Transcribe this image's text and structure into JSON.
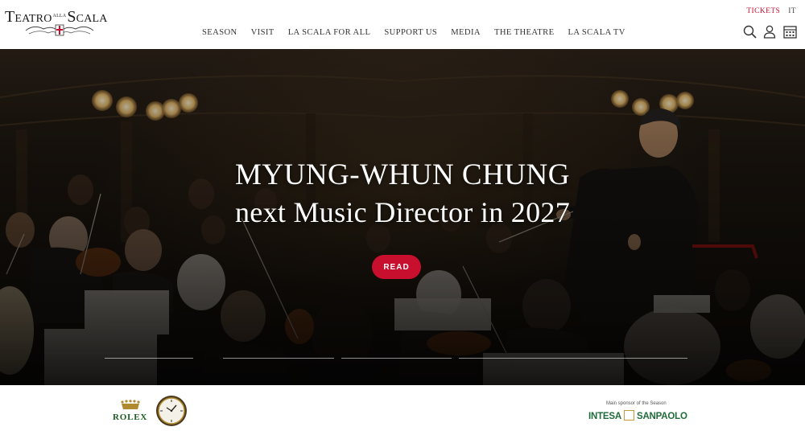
{
  "header": {
    "logo": {
      "part1": "Teatro",
      "part2": "alla",
      "part3": "Scala"
    },
    "nav": [
      "SEASON",
      "VISIT",
      "LA SCALA FOR ALL",
      "SUPPORT US",
      "MEDIA",
      "THE THEATRE",
      "LA SCALA TV"
    ],
    "tickets_label": "TICKETS",
    "lang_label": "IT",
    "icons": [
      "search-icon",
      "user-icon",
      "calendar-icon"
    ],
    "accent_color": "#c8102e"
  },
  "hero": {
    "title_line1": "MYUNG-WHUN CHUNG",
    "title_line2": "next Music Director in 2027",
    "button_label": "READ"
  },
  "sponsors": {
    "rolex_label": "ROLEX",
    "intesa_caption": "Main sponsor of the Season",
    "intesa_left": "INTESA",
    "intesa_right": "SANPAOLO"
  }
}
